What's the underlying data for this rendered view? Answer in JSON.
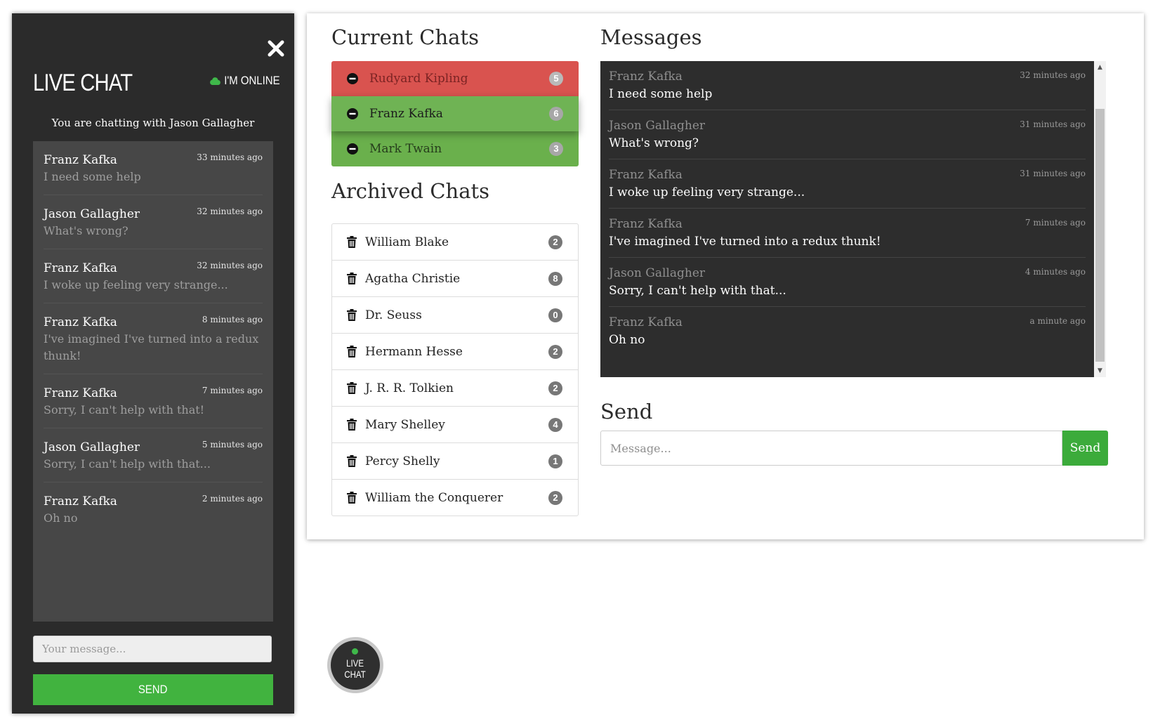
{
  "widget": {
    "title": "LIVE CHAT",
    "status": "I'M ONLINE",
    "chatting_with": "You are chatting with Jason Gallagher",
    "messages": [
      {
        "name": "Franz Kafka",
        "time": "33 minutes ago",
        "text": "I need some help"
      },
      {
        "name": "Jason Gallagher",
        "time": "32 minutes ago",
        "text": "What's wrong?"
      },
      {
        "name": "Franz Kafka",
        "time": "32 minutes ago",
        "text": "I woke up feeling very strange..."
      },
      {
        "name": "Franz Kafka",
        "time": "8 minutes ago",
        "text": "I've imagined I've turned into a redux thunk!"
      },
      {
        "name": "Franz Kafka",
        "time": "7 minutes ago",
        "text": "Sorry, I can't help with that!"
      },
      {
        "name": "Jason Gallagher",
        "time": "5 minutes ago",
        "text": "Sorry, I can't help with that..."
      },
      {
        "name": "Franz Kafka",
        "time": "2 minutes ago",
        "text": "Oh no"
      }
    ],
    "input_placeholder": "Your message...",
    "send_label": "SEND"
  },
  "panel": {
    "current_title": "Current Chats",
    "current_chats": [
      {
        "name": "Rudyard Kipling",
        "count": "5",
        "state": "red"
      },
      {
        "name": "Franz Kafka",
        "count": "6",
        "state": "active"
      },
      {
        "name": "Mark Twain",
        "count": "3",
        "state": "green"
      }
    ],
    "archived_title": "Archived Chats",
    "archived_chats": [
      {
        "name": "William Blake",
        "count": "2"
      },
      {
        "name": "Agatha Christie",
        "count": "8"
      },
      {
        "name": "Dr. Seuss",
        "count": "0"
      },
      {
        "name": "Hermann Hesse",
        "count": "2"
      },
      {
        "name": "J. R. R. Tolkien",
        "count": "2"
      },
      {
        "name": "Mary Shelley",
        "count": "4"
      },
      {
        "name": "Percy Shelly",
        "count": "1"
      },
      {
        "name": "William the Conquerer",
        "count": "2"
      }
    ],
    "messages_title": "Messages",
    "messages": [
      {
        "name": "Franz Kafka",
        "time": "32 minutes ago",
        "text": "I need some help"
      },
      {
        "name": "Jason Gallagher",
        "time": "31 minutes ago",
        "text": "What's wrong?"
      },
      {
        "name": "Franz Kafka",
        "time": "31 minutes ago",
        "text": "I woke up feeling very strange..."
      },
      {
        "name": "Franz Kafka",
        "time": "7 minutes ago",
        "text": "I've imagined I've turned into a redux thunk!"
      },
      {
        "name": "Jason Gallagher",
        "time": "4 minutes ago",
        "text": "Sorry, I can't help with that..."
      },
      {
        "name": "Franz Kafka",
        "time": "a minute ago",
        "text": "Oh no"
      }
    ],
    "send_title": "Send",
    "message_placeholder": "Message...",
    "send_button": "Send"
  },
  "fab": {
    "line1": "LIVE",
    "line2": "CHAT"
  },
  "colors": {
    "accent_green": "#41b33f",
    "danger_red": "#d9534f",
    "success_green": "#6ab04c",
    "dark_panel": "#2b2b2b"
  },
  "icons": {
    "close": "close-icon",
    "online": "cloud-icon",
    "current_chat": "minus-circle-icon",
    "archived_chat": "trash-icon"
  }
}
